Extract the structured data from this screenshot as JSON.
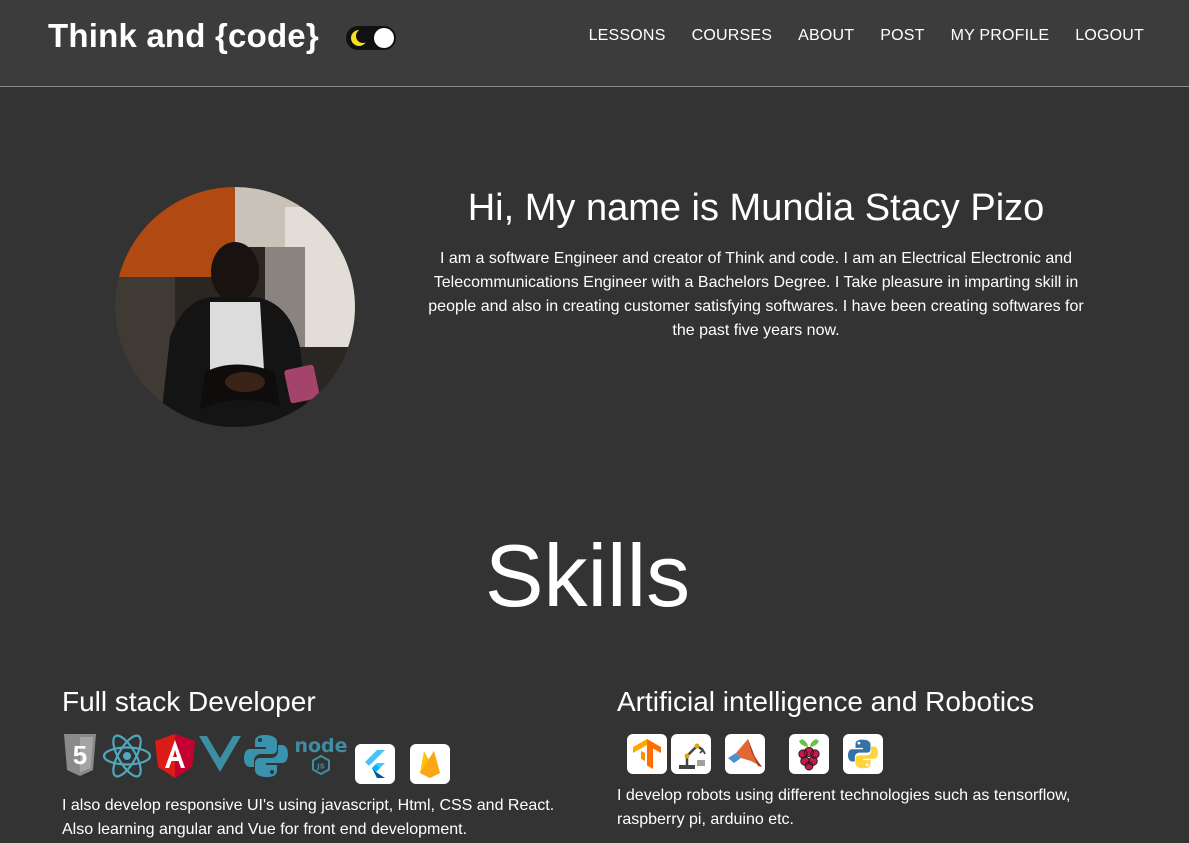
{
  "navbar": {
    "brand": "Think and {code}",
    "links": [
      "LESSONS",
      "COURSES",
      "ABOUT",
      "POST",
      "MY PROFILE",
      "LOGOUT"
    ]
  },
  "hero": {
    "title": "Hi, My name is Mundia Stacy Pizo",
    "text": "I am a software Engineer and creator of Think and code. I am an Electrical Electronic and Telecommunications Engineer with a Bachelors Degree. I Take pleasure in imparting skill in people and also in creating customer satisfying softwares. I have been creating softwares for the past five years now."
  },
  "skills": {
    "title": "Skills",
    "fullstack": {
      "heading": "Full stack Developer",
      "icons": [
        "html5-icon",
        "react-icon",
        "angular-icon",
        "vue-icon",
        "python-icon",
        "nodejs-icon",
        "flutter-icon",
        "firebase-icon"
      ],
      "text": "I also develop responsive UI's using javascript, Html, CSS and React. Also learning angular and Vue for front end development."
    },
    "ai": {
      "heading": "Artificial intelligence and Robotics",
      "icons": [
        "tensorflow-icon",
        "robot-arm-icon",
        "matlab-icon",
        "raspberry-pi-icon",
        "python-icon"
      ],
      "text": "I develop robots using different technologies such as tensorflow, raspberry pi, arduino etc."
    }
  },
  "colors": {
    "background": "#333333",
    "navbar": "#3c3c3c",
    "text": "#ffffff",
    "html5": "#8a8a8a",
    "react": "#4fa8bd",
    "angular": "#dd1b16",
    "vue": "#3d8ea3",
    "python": "#3a93ad",
    "node": "#3d8ea3"
  }
}
